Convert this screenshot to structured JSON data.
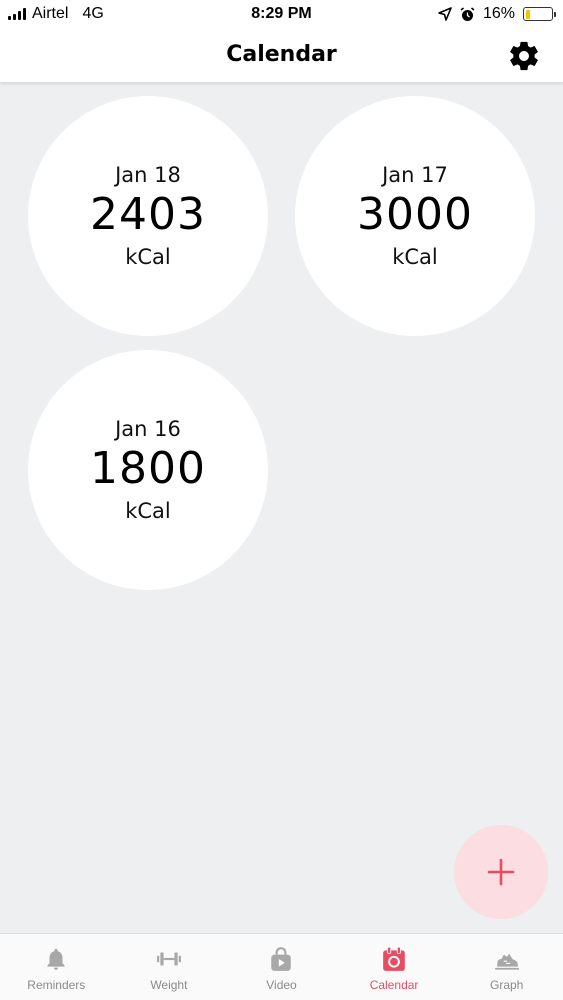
{
  "status_bar": {
    "carrier": "Airtel",
    "network": "4G",
    "time": "8:29 PM",
    "battery": "16%",
    "battery_level": 0.16
  },
  "header": {
    "title": "Calendar",
    "settings_icon": "gear-icon"
  },
  "days": [
    {
      "date": "Jan 18",
      "value": "2403",
      "unit": "kCal"
    },
    {
      "date": "Jan 17",
      "value": "3000",
      "unit": "kCal"
    },
    {
      "date": "Jan 16",
      "value": "1800",
      "unit": "kCal"
    }
  ],
  "fab": {
    "icon": "plus-icon"
  },
  "tabs": [
    {
      "label": "Reminders",
      "icon": "bell-icon"
    },
    {
      "label": "Weight",
      "icon": "dumbbell-icon"
    },
    {
      "label": "Video",
      "icon": "video-icon"
    },
    {
      "label": "Calendar",
      "icon": "calendar-icon",
      "active": true
    },
    {
      "label": "Graph",
      "icon": "shoe-icon"
    }
  ],
  "colors": {
    "accent": "#e84c63",
    "background": "#eeeff0",
    "fab": "#fcdde2",
    "inactive_tab": "#8a8a8a"
  }
}
